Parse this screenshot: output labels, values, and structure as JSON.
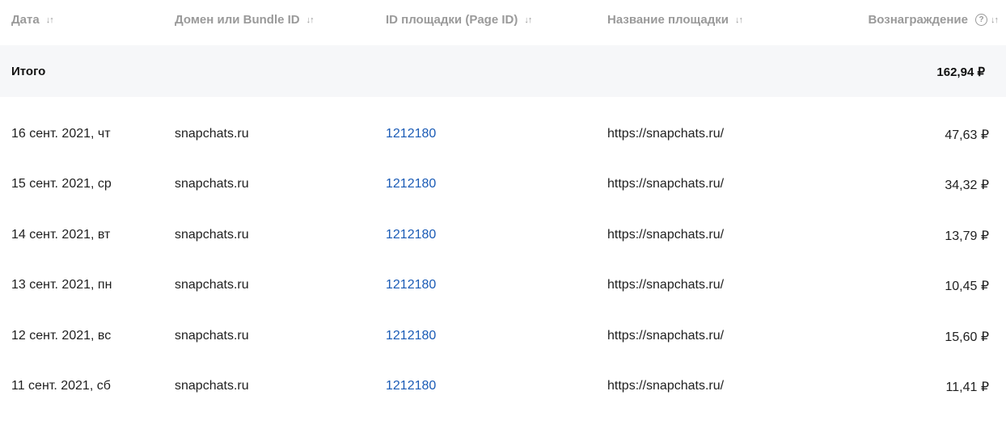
{
  "columns": [
    {
      "label": "Дата",
      "sort_icon": "sort-icon"
    },
    {
      "label": "Домен или Bundle ID",
      "sort_icon": "sort-icon"
    },
    {
      "label": "ID площадки (Page ID)",
      "sort_icon": "sort-icon"
    },
    {
      "label": "Название площадки",
      "sort_icon": "sort-icon"
    },
    {
      "label": "Вознаграждение",
      "sort_icon": "sort-icon",
      "help_icon": "help-icon"
    }
  ],
  "sort_glyph": "↓↑",
  "help_glyph": "?",
  "total": {
    "label": "Итого",
    "value": "162,94 ₽"
  },
  "rows": [
    {
      "date": "16 сент. 2021, чт",
      "domain": "snapchats.ru",
      "page_id": "1212180",
      "name": "https://snapchats.ru/",
      "reward": "47,63 ₽"
    },
    {
      "date": "15 сент. 2021, ср",
      "domain": "snapchats.ru",
      "page_id": "1212180",
      "name": "https://snapchats.ru/",
      "reward": "34,32 ₽"
    },
    {
      "date": "14 сент. 2021, вт",
      "domain": "snapchats.ru",
      "page_id": "1212180",
      "name": "https://snapchats.ru/",
      "reward": "13,79 ₽"
    },
    {
      "date": "13 сент. 2021, пн",
      "domain": "snapchats.ru",
      "page_id": "1212180",
      "name": "https://snapchats.ru/",
      "reward": "10,45 ₽"
    },
    {
      "date": "12 сент. 2021, вс",
      "domain": "snapchats.ru",
      "page_id": "1212180",
      "name": "https://snapchats.ru/",
      "reward": "15,60 ₽"
    },
    {
      "date": "11 сент. 2021, сб",
      "domain": "snapchats.ru",
      "page_id": "1212180",
      "name": "https://snapchats.ru/",
      "reward": "11,41 ₽"
    }
  ],
  "colors": {
    "link": "#1a5bb6",
    "header_text": "#9a9a9a",
    "total_bg": "#f6f7f9"
  }
}
